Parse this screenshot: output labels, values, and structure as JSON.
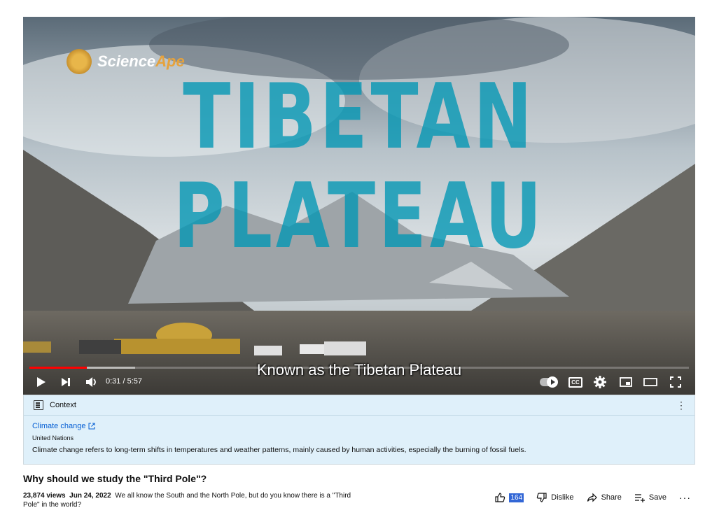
{
  "player": {
    "watermark": {
      "brand_main": "Science",
      "brand_accent": "Ape"
    },
    "overlay_title_line1": "TIBETAN",
    "overlay_title_line2": "PLATEAU",
    "caption": "Known as the Tibetan Plateau",
    "time": "0:31 / 5:57",
    "progress_played_fraction": 0.087,
    "progress_buffered_fraction": 0.16,
    "controls": {
      "play": "play-icon",
      "next": "skip-next-icon",
      "volume": "volume-icon",
      "autoplay": "autoplay-toggle",
      "cc_label": "CC",
      "settings": "gear-icon",
      "miniplayer": "miniplayer-icon",
      "theater": "theater-icon",
      "fullscreen": "fullscreen-icon"
    },
    "colors": {
      "progress": "#ff0000",
      "title_overlay": "#0096b4"
    }
  },
  "context": {
    "header": "Context",
    "link_text": "Climate change",
    "source": "United Nations",
    "description": "Climate change refers to long-term shifts in temperatures and weather patterns, mainly caused by human activities, especially the burning of fossil fuels."
  },
  "video": {
    "title": "Why should we study the \"Third Pole\"?",
    "views": "23,874 views",
    "date": "Jun 24, 2022",
    "description": "We all know the South and the North Pole, but do you know there is a \"Third Pole\" in the world?"
  },
  "actions": {
    "like_count": "164",
    "dislike_label": "Dislike",
    "share_label": "Share",
    "save_label": "Save"
  }
}
